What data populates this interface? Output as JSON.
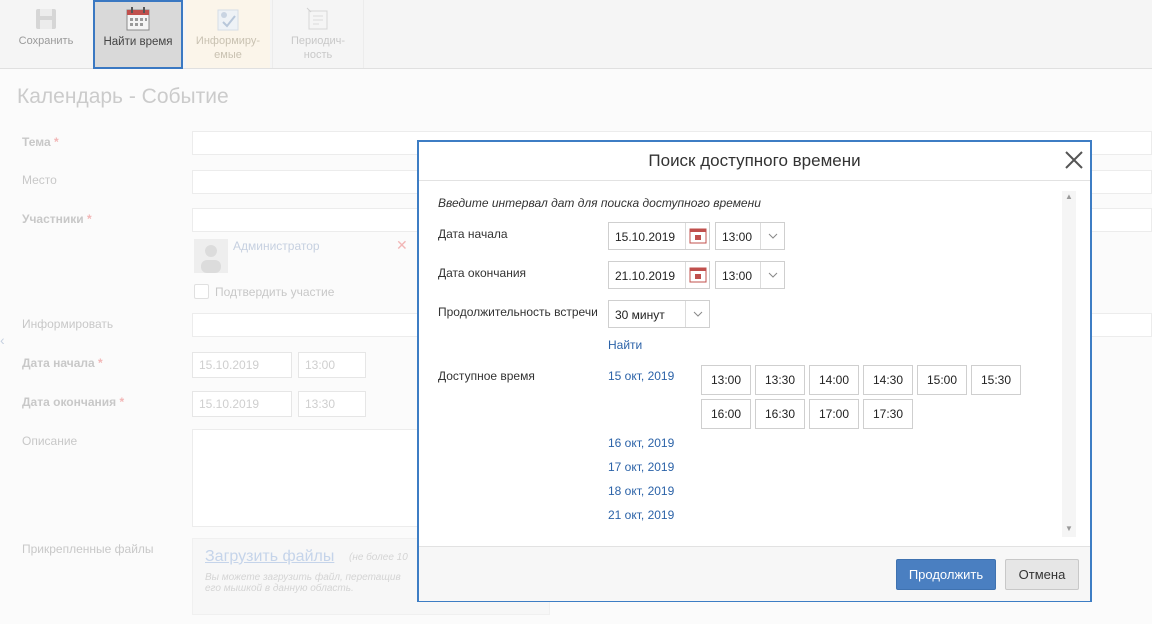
{
  "toolbar": {
    "save_label": "Сохранить",
    "find_time_label": "Найти время",
    "inform_label_1": "Информиру-",
    "inform_label_2": "емые",
    "periodic_label_1": "Периодич-",
    "periodic_label_2": "ность"
  },
  "form": {
    "page_title": "Календарь - Событие",
    "subject_label": "Тема",
    "place_label": "Место",
    "participants_label": "Участники",
    "participant_name": "Администратор",
    "confirm_label": "Подтвердить участие",
    "inform_label": "Информировать",
    "start_label": "Дата начала",
    "start_date": "15.10.2019",
    "start_time": "13:00",
    "end_label": "Дата окончания",
    "end_date": "15.10.2019",
    "end_time": "13:30",
    "description_label": "Описание",
    "attachments_label": "Прикрепленные файлы",
    "upload_link": "Загрузить файлы",
    "upload_note": "(не более 10",
    "upload_hint": "Вы можете загрузить файл, перетащив его мышкой в данную область."
  },
  "dialog": {
    "title": "Поиск доступного времени",
    "hint": "Введите интервал дат для поиска доступного времени",
    "start_label": "Дата начала",
    "start_date": "15.10.2019",
    "start_time": "13:00",
    "end_label": "Дата окончания",
    "end_date": "21.10.2019",
    "end_time": "13:00",
    "duration_label": "Продолжительность встречи",
    "duration_value": "30 минут",
    "find_link": "Найти",
    "available_label": "Доступное время",
    "days": [
      {
        "date": "15 окт, 2019",
        "slots": [
          "13:00",
          "13:30",
          "14:00",
          "14:30",
          "15:00",
          "15:30",
          "16:00",
          "16:30",
          "17:00",
          "17:30"
        ]
      },
      {
        "date": "16 окт, 2019",
        "slots": []
      },
      {
        "date": "17 окт, 2019",
        "slots": []
      },
      {
        "date": "18 окт, 2019",
        "slots": []
      },
      {
        "date": "21 окт, 2019",
        "slots": []
      }
    ],
    "continue_label": "Продолжить",
    "cancel_label": "Отмена"
  },
  "colors": {
    "accent": "#4a7fc1",
    "link": "#2c63a8",
    "focus_border": "#3d7dc4",
    "required_mark": "#f2b6b6"
  },
  "icons": [
    "save-icon",
    "calendar-icon",
    "inform-icon",
    "periodic-icon",
    "close-icon",
    "chevron-down-icon",
    "remove-icon",
    "avatar-icon"
  ]
}
